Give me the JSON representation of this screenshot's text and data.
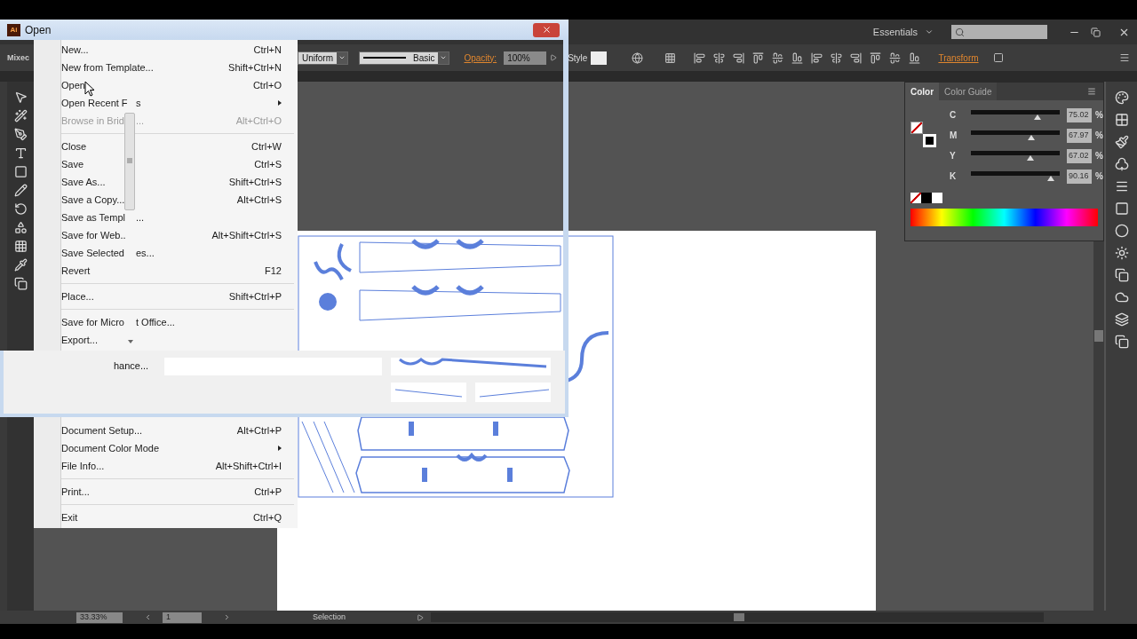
{
  "dialog": {
    "app_badge": "Ai",
    "title": "Open",
    "fragment": "hance..."
  },
  "app_bar": {
    "workspace": "Essentials"
  },
  "control_bar": {
    "left_fragment": "Mixec",
    "stroke_profile": "Uniform",
    "brush": "Basic",
    "opacity_label": "Opacity:",
    "opacity": "100%",
    "style_label": "Style",
    "transform": "Transform"
  },
  "file_menu": {
    "top": [
      {
        "label": "New...",
        "shortcut": "Ctrl+N",
        "disabled": false,
        "submenu": false,
        "separator_after": false
      },
      {
        "label": "New from Template...",
        "shortcut": "Shift+Ctrl+N",
        "disabled": false,
        "submenu": false,
        "separator_after": false
      },
      {
        "label": "Open",
        "shortcut": "Ctrl+O",
        "disabled": false,
        "submenu": false,
        "separator_after": false
      },
      {
        "label": "Open Recent F",
        "after": "s",
        "disabled": false,
        "submenu": true,
        "separator_after": false
      },
      {
        "label": "Browse in Brid",
        "after": "...",
        "shortcut": "Alt+Ctrl+O",
        "disabled": true,
        "submenu": false,
        "separator_after": true
      },
      {
        "label": "Close",
        "shortcut": "Ctrl+W",
        "disabled": false,
        "submenu": false,
        "separator_after": false
      },
      {
        "label": "Save",
        "shortcut": "Ctrl+S",
        "disabled": false,
        "submenu": false,
        "separator_after": false
      },
      {
        "label": "Save As...",
        "shortcut": "Shift+Ctrl+S",
        "disabled": false,
        "submenu": false,
        "separator_after": false
      },
      {
        "label": "Save a Copy...",
        "shortcut": "Alt+Ctrl+S",
        "disabled": false,
        "submenu": false,
        "separator_after": false
      },
      {
        "label": "Save as Templ",
        "after": "...",
        "disabled": false,
        "submenu": false,
        "separator_after": false
      },
      {
        "label": "Save for Web..",
        "shortcut": "Alt+Shift+Ctrl+S",
        "disabled": false,
        "submenu": false,
        "separator_after": false
      },
      {
        "label": "Save Selected",
        "after": "es...",
        "disabled": false,
        "submenu": false,
        "separator_after": false
      },
      {
        "label": "Revert",
        "shortcut": "F12",
        "disabled": false,
        "submenu": false,
        "separator_after": true
      },
      {
        "label": "Place...",
        "shortcut": "Shift+Ctrl+P",
        "disabled": false,
        "submenu": false,
        "separator_after": true
      },
      {
        "label": "Save for Micro",
        "after": "t Office...",
        "disabled": false,
        "submenu": false,
        "separator_after": false
      },
      {
        "label": "Export...",
        "disabled": false,
        "submenu": false,
        "separator_after": false
      }
    ],
    "bottom": [
      {
        "label": "Document Setup...",
        "shortcut": "Alt+Ctrl+P",
        "disabled": false,
        "submenu": false,
        "separator_after": false
      },
      {
        "label": "Document Color Mode",
        "disabled": false,
        "submenu": true,
        "separator_after": false
      },
      {
        "label": "File Info...",
        "shortcut": "Alt+Shift+Ctrl+I",
        "disabled": false,
        "submenu": false,
        "separator_after": true
      },
      {
        "label": "Print...",
        "shortcut": "Ctrl+P",
        "disabled": false,
        "submenu": false,
        "separator_after": true
      },
      {
        "label": "Exit",
        "shortcut": "Ctrl+Q",
        "disabled": false,
        "submenu": false,
        "separator_after": false
      }
    ]
  },
  "color_panel": {
    "tabs": [
      {
        "label": "Color",
        "selected": true
      },
      {
        "label": "Color Guide",
        "selected": false
      }
    ],
    "channels": [
      {
        "label": "C",
        "level": 0.75,
        "value": "75.02",
        "unit": "%"
      },
      {
        "label": "M",
        "level": 0.68,
        "value": "67.97",
        "unit": "%"
      },
      {
        "label": "Y",
        "level": 0.67,
        "value": "67.02",
        "unit": "%"
      },
      {
        "label": "K",
        "level": 0.9,
        "value": "90.16",
        "unit": "%"
      }
    ]
  },
  "status_bar": {
    "zoom": "33.33%",
    "artboard": "1",
    "tool": "Selection"
  }
}
